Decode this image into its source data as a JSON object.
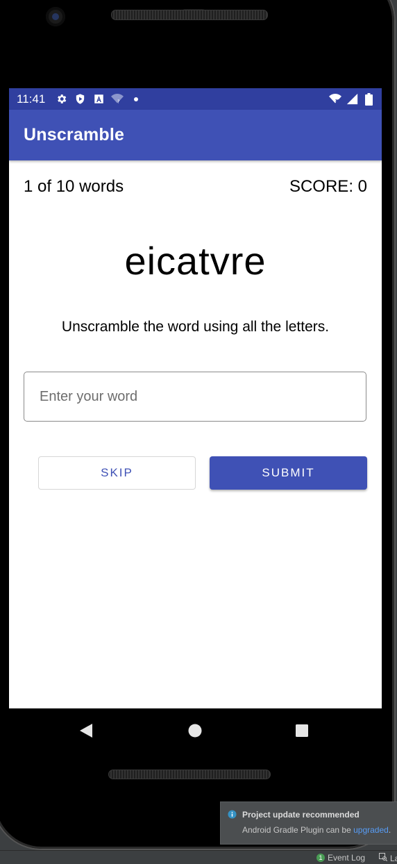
{
  "status_bar": {
    "time": "11:41",
    "icons_left": [
      "gear-icon",
      "shield-play-icon",
      "a-box-icon",
      "wifi-question-icon",
      "dot-icon"
    ],
    "icons_right": [
      "wifi-x-icon",
      "cell-signal-icon",
      "battery-icon"
    ]
  },
  "app_bar": {
    "title": "Unscramble"
  },
  "game": {
    "progress": "1 of 10 words",
    "score": "SCORE: 0",
    "scrambled_word": "eicatvre",
    "instructions": "Unscramble the word using all the letters.",
    "input_placeholder": "Enter your word",
    "input_value": "",
    "skip_label": "SKIP",
    "submit_label": "SUBMIT"
  },
  "nav_bar": {
    "buttons": [
      "back-icon",
      "home-icon",
      "recents-icon"
    ]
  },
  "ide": {
    "notification_title": "Project update recommended",
    "notification_body": "Android Gradle Plugin can be ",
    "notification_link": "upgraded",
    "notification_suffix": ".",
    "event_log_count": "1",
    "event_log_label": "Event Log",
    "layout_label": "La"
  },
  "colors": {
    "primary": "#3f51b5",
    "primary_dark": "#303f9f",
    "ide_background": "#3c3f41"
  }
}
